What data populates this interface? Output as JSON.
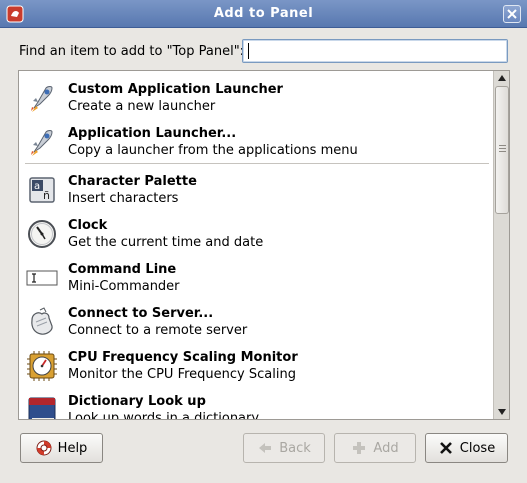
{
  "window": {
    "title": "Add to Panel"
  },
  "find": {
    "label": "Find an item to add to \"Top Panel\":",
    "value": ""
  },
  "items": [
    {
      "name": "Custom Application Launcher",
      "desc": "Create a new launcher",
      "icon": "rocket-icon"
    },
    {
      "name": "Application Launcher...",
      "desc": "Copy a launcher from the applications menu",
      "icon": "rocket-icon"
    },
    {
      "name": "Character Palette",
      "desc": "Insert characters",
      "icon": "character-palette-icon"
    },
    {
      "name": "Clock",
      "desc": "Get the current time and date",
      "icon": "clock-icon"
    },
    {
      "name": "Command Line",
      "desc": "Mini-Commander",
      "icon": "terminal-icon"
    },
    {
      "name": "Connect to Server...",
      "desc": "Connect to a remote server",
      "icon": "network-server-icon"
    },
    {
      "name": "CPU Frequency Scaling Monitor",
      "desc": "Monitor the CPU Frequency Scaling",
      "icon": "cpu-gauge-icon"
    },
    {
      "name": "Dictionary Look up",
      "desc": "Look up words in a dictionary",
      "icon": "dictionary-icon"
    }
  ],
  "buttons": {
    "help": "Help",
    "back": "Back",
    "add": "Add",
    "close": "Close"
  }
}
